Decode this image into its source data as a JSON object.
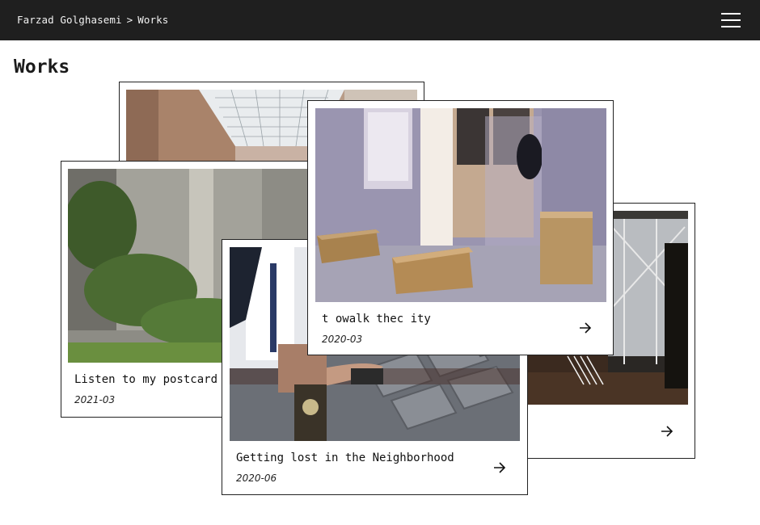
{
  "header": {
    "breadcrumb": {
      "home": "Farzad Golghasemi",
      "separator": ">",
      "current": "Works"
    },
    "menu_icon": "hamburger-menu-icon",
    "background": "#1f1f1f"
  },
  "page": {
    "title": "Works"
  },
  "works": [
    {
      "title": "",
      "date": "",
      "image": "gallery-skylight-photo"
    },
    {
      "title": "",
      "date": "",
      "image": "dark-hall-installation-photo",
      "arrow_icon": "arrow-right-icon"
    },
    {
      "title": "Listen to my postcard",
      "date": "2021-03",
      "image": "overgrown-concrete-wall-photo"
    },
    {
      "title": "Getting lost in the Neighborhood",
      "date": "2020-06",
      "image": "hand-over-pavement-photo",
      "arrow_icon": "arrow-right-icon"
    },
    {
      "title": "t owalk thec ity",
      "date": "2020-03",
      "image": "room-with-wooden-boxes-photo",
      "arrow_icon": "arrow-right-icon"
    }
  ]
}
